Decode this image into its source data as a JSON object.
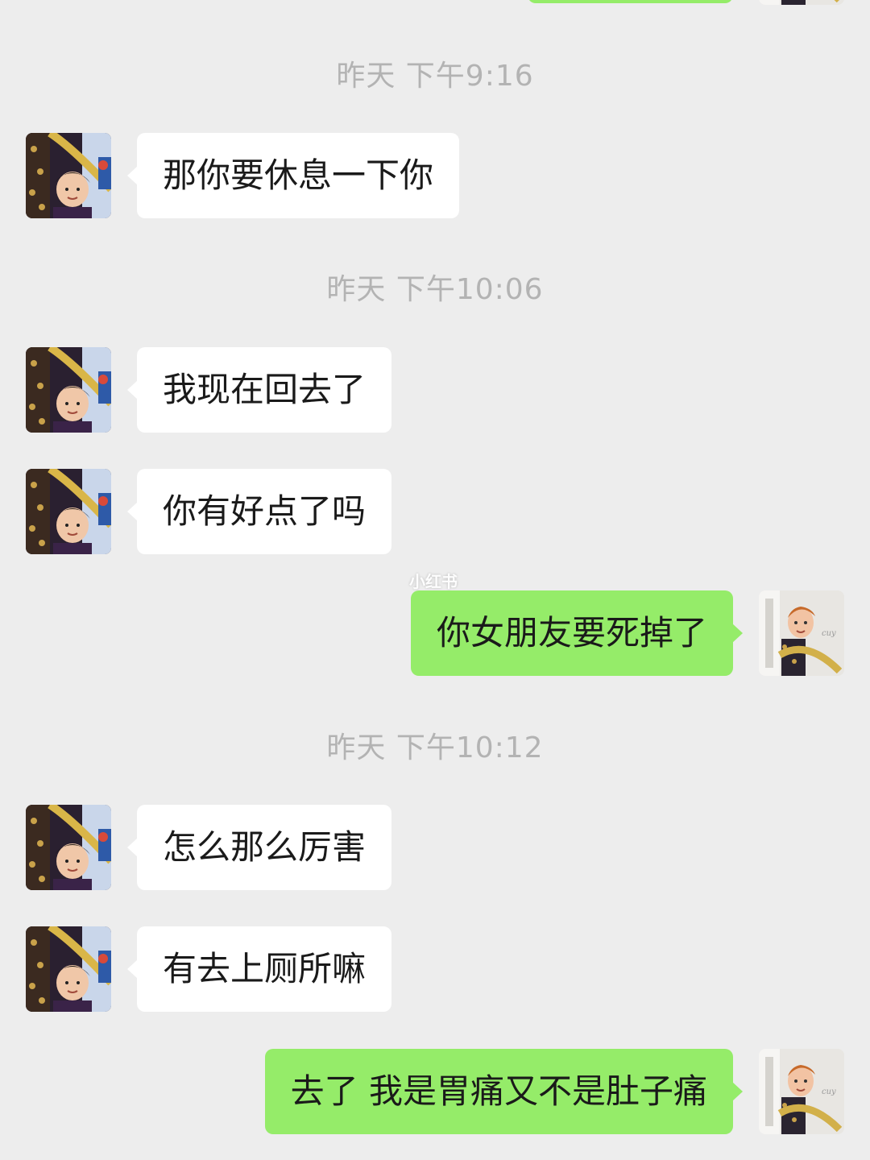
{
  "chat": {
    "timestamps": [
      "昨天 下午9:16",
      "昨天 下午10:06",
      "昨天 下午10:12"
    ],
    "messages": [
      {
        "side": "received",
        "text": "那你要休息一下你"
      },
      {
        "side": "received",
        "text": "我现在回去了"
      },
      {
        "side": "received",
        "text": "你有好点了吗"
      },
      {
        "side": "sent",
        "text": "你女朋友要死掉了"
      },
      {
        "side": "received",
        "text": "怎么那么厉害"
      },
      {
        "side": "received",
        "text": "有去上厕所嘛"
      },
      {
        "side": "sent",
        "text": "去了 我是胃痛又不是肚子痛"
      }
    ]
  },
  "watermark": "小红书",
  "colors": {
    "background": "#ededed",
    "received_bubble": "#ffffff",
    "sent_bubble": "#95ec69",
    "timestamp_text": "#b3b3b3"
  }
}
